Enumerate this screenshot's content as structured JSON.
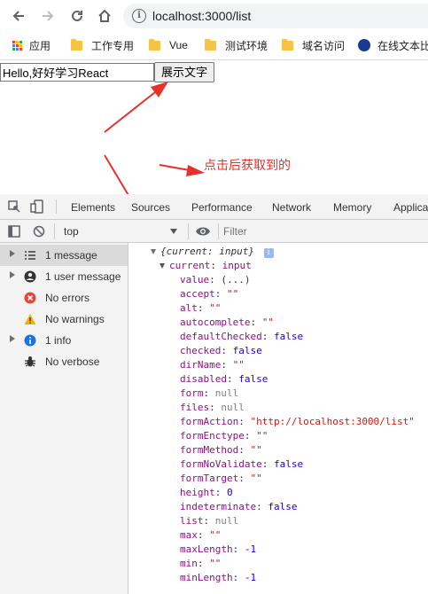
{
  "browser": {
    "url": "localhost:3000/list",
    "bookmarks": [
      "应用",
      "工作专用",
      "Vue",
      "测试环境",
      "域名访问",
      "在线文本比"
    ]
  },
  "page": {
    "input_value": "Hello,好好学习React",
    "button_label": "展示文字",
    "annotation": "点击后获取到的"
  },
  "devtools": {
    "tabs": [
      "Elements",
      "Sources",
      "Performance",
      "Network",
      "Memory",
      "Applica"
    ],
    "context": "top",
    "filter_placeholder": "Filter",
    "sidebar": [
      {
        "label": "1 message",
        "icon": "list-icon"
      },
      {
        "label": "1 user message",
        "icon": "user-icon"
      },
      {
        "label": "No errors",
        "icon": "error-icon"
      },
      {
        "label": "No warnings",
        "icon": "warning-icon"
      },
      {
        "label": "1 info",
        "icon": "info-icon"
      },
      {
        "label": "No verbose",
        "icon": "bug-icon"
      }
    ],
    "console": {
      "header": "{current: input}",
      "current_label": "current",
      "current_type": "input",
      "props": [
        {
          "key": "value",
          "val": "(...)",
          "kind": "plain"
        },
        {
          "key": "accept",
          "val": "\"\"",
          "kind": "string"
        },
        {
          "key": "alt",
          "val": "\"\"",
          "kind": "string"
        },
        {
          "key": "autocomplete",
          "val": "\"\"",
          "kind": "string"
        },
        {
          "key": "defaultChecked",
          "val": "false",
          "kind": "literal"
        },
        {
          "key": "checked",
          "val": "false",
          "kind": "literal"
        },
        {
          "key": "dirName",
          "val": "\"\"",
          "kind": "string"
        },
        {
          "key": "disabled",
          "val": "false",
          "kind": "literal"
        },
        {
          "key": "form",
          "val": "null",
          "kind": "null"
        },
        {
          "key": "files",
          "val": "null",
          "kind": "null"
        },
        {
          "key": "formAction",
          "val": "\"http://localhost:3000/list\"",
          "kind": "string"
        },
        {
          "key": "formEnctype",
          "val": "\"\"",
          "kind": "string"
        },
        {
          "key": "formMethod",
          "val": "\"\"",
          "kind": "string"
        },
        {
          "key": "formNoValidate",
          "val": "false",
          "kind": "literal"
        },
        {
          "key": "formTarget",
          "val": "\"\"",
          "kind": "string"
        },
        {
          "key": "height",
          "val": "0",
          "kind": "literal"
        },
        {
          "key": "indeterminate",
          "val": "false",
          "kind": "literal"
        },
        {
          "key": "list",
          "val": "null",
          "kind": "null"
        },
        {
          "key": "max",
          "val": "\"\"",
          "kind": "string"
        },
        {
          "key": "maxLength",
          "val": "-1",
          "kind": "literal"
        },
        {
          "key": "min",
          "val": "\"\"",
          "kind": "string"
        },
        {
          "key": "minLength",
          "val": "-1",
          "kind": "literal"
        }
      ]
    }
  },
  "colors": {
    "annotation": "#e8302a",
    "key": "#881280",
    "string": "#c41a16",
    "literal": "#1c00cf"
  }
}
